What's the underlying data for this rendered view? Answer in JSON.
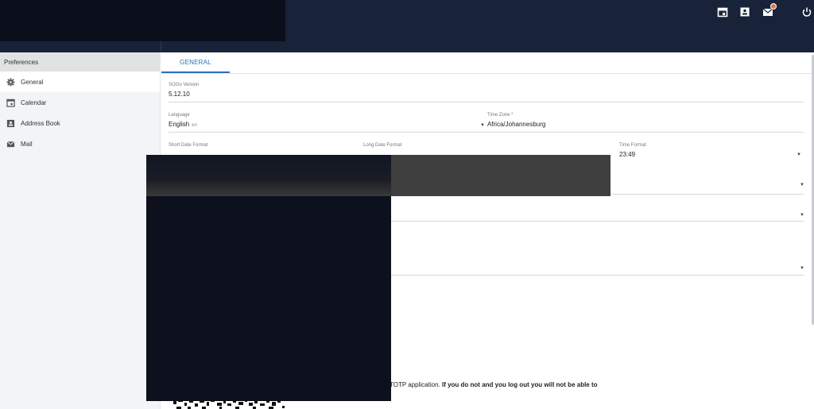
{
  "topbar": {
    "icons": [
      "calendar-icon",
      "contacts-icon",
      "mail-icon",
      "power-icon"
    ]
  },
  "sidebar": {
    "header": "Preferences",
    "items": [
      {
        "label": "General",
        "icon": "gear-icon"
      },
      {
        "label": "Calendar",
        "icon": "calendar-icon"
      },
      {
        "label": "Address Book",
        "icon": "contacts-icon"
      },
      {
        "label": "Mail",
        "icon": "mail-icon"
      }
    ]
  },
  "main": {
    "tab_general": "GENERAL",
    "version": {
      "label": "SOGo Version",
      "value": "5.12.10"
    },
    "language": {
      "label": "Language",
      "value": "English",
      "hint": "en"
    },
    "timezone": {
      "label": "Time Zone",
      "value": "Africa/Johannesburg"
    },
    "short_date": {
      "label": "Short Date Format"
    },
    "long_date": {
      "label": "Long Date Format"
    },
    "time_format": {
      "label": "Time Format",
      "value": "23:49"
    },
    "totp": {
      "text_a": "TOTP application.",
      "text_b": "If you do not and you log out you will not be able to"
    }
  },
  "colors": {
    "topbar": "#182239",
    "accent": "#2a6ebb",
    "sidebar_bg": "#f2f4f7"
  }
}
